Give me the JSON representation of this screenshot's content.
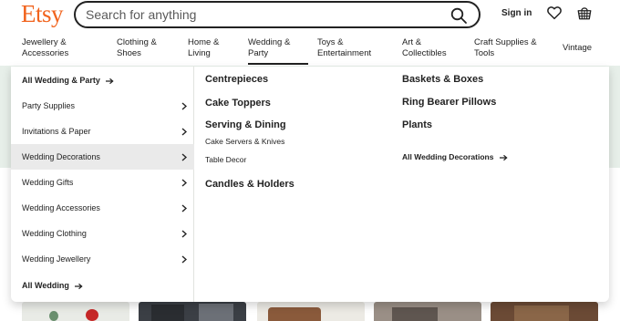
{
  "header": {
    "logo": "Etsy",
    "search_placeholder": "Search for anything",
    "sign_in": "Sign in",
    "icons": {
      "search": "search-icon",
      "favorites": "heart-icon",
      "cart": "basket-icon"
    }
  },
  "categories": [
    {
      "line1": "Jewellery &",
      "line2": "Accessories"
    },
    {
      "line1": "Clothing &",
      "line2": "Shoes"
    },
    {
      "line1": "Home &",
      "line2": "Living"
    },
    {
      "line1": "Wedding &",
      "line2": "Party"
    },
    {
      "line1": "Toys &",
      "line2": "Entertainment"
    },
    {
      "line1": "Art &",
      "line2": "Collectibles"
    },
    {
      "line1": "Craft Supplies &",
      "line2": "Tools"
    },
    {
      "line1": "Vintage",
      "line2": ""
    }
  ],
  "menu": {
    "left": [
      {
        "label": "All Wedding & Party"
      },
      {
        "label": "Party Supplies"
      },
      {
        "label": "Invitations & Paper"
      },
      {
        "label": "Wedding Decorations"
      },
      {
        "label": "Wedding Gifts"
      },
      {
        "label": "Wedding Accessories"
      },
      {
        "label": "Wedding Clothing"
      },
      {
        "label": "Wedding Jewellery"
      },
      {
        "label": "All Wedding"
      }
    ],
    "col1": {
      "centrepieces": "Centrepieces",
      "cake_toppers": "Cake Toppers",
      "serving_dining": "Serving & Dining",
      "cake_servers": "Cake Servers & Knives",
      "table_decor": "Table Decor",
      "candles": "Candles & Holders"
    },
    "col2": {
      "baskets": "Baskets & Boxes",
      "ring_bearer": "Ring Bearer Pillows",
      "plants": "Plants",
      "all_decorations": "All Wedding Decorations"
    }
  },
  "colors": {
    "brand": "#f1641e",
    "selected_row": "#eaeaea",
    "background_band": "#e7efe9"
  }
}
